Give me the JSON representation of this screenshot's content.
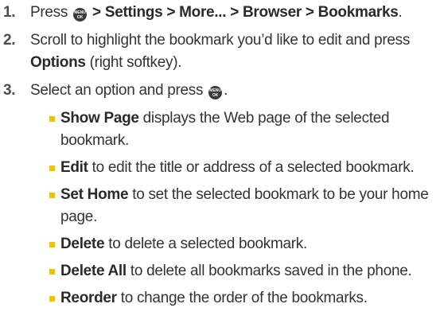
{
  "steps": [
    {
      "number": "1.",
      "text_press": "Press",
      "path": " > Settings > More... > Browser > Bookmarks",
      "end": "."
    },
    {
      "number": "2.",
      "text_a": "Scroll to highlight the bookmark you’d like to edit and press ",
      "options": "Options",
      "text_b": " (right softkey)."
    },
    {
      "number": "3.",
      "text_a": "Select an option and press",
      "end": "."
    }
  ],
  "key_icon": {
    "name": "menu-ok-key-icon",
    "line1": "MENU",
    "line2": "OK"
  },
  "options": [
    {
      "term": "Show Page",
      "desc": " displays the Web page of the selected bookmark."
    },
    {
      "term": "Edit",
      "desc": " to edit the title or address of a selected bookmark."
    },
    {
      "term": "Set Home",
      "desc": " to set the selected bookmark to be your home page."
    },
    {
      "term": "Delete",
      "desc": " to delete a selected bookmark."
    },
    {
      "term": "Delete All",
      "desc": " to delete all bookmarks saved in the phone."
    },
    {
      "term": "Reorder",
      "desc": " to change the order of the bookmarks."
    }
  ],
  "colors": {
    "bullet": "#f2c200",
    "text": "#333333"
  }
}
